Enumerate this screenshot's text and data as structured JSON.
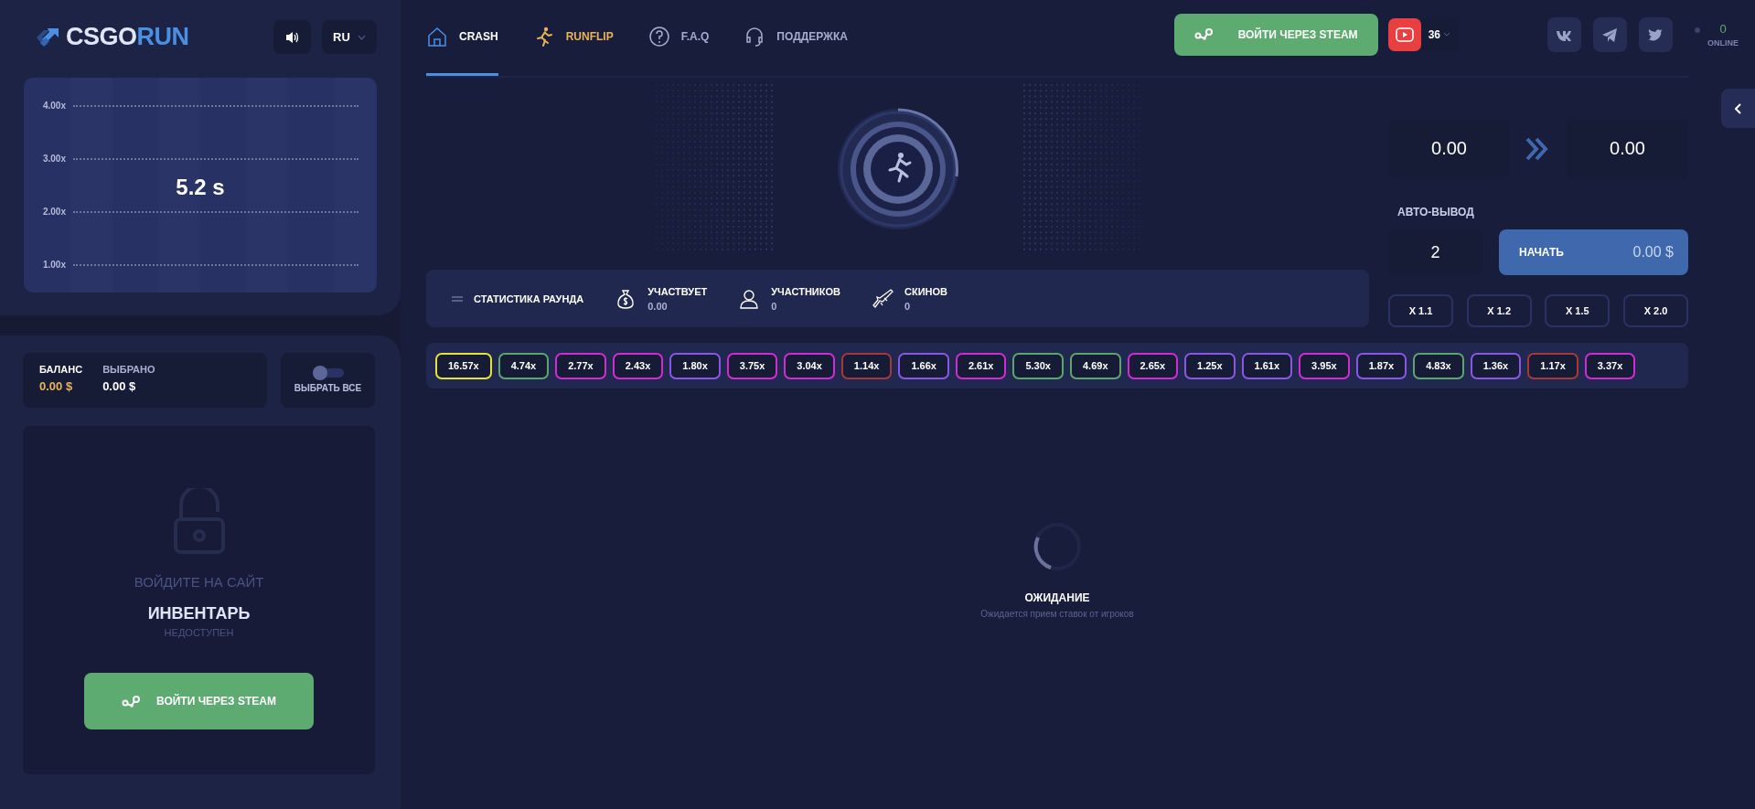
{
  "logo": {
    "text_main": "CSGO",
    "text_accent": "RUN"
  },
  "language": {
    "code": "RU"
  },
  "timer_chart": {
    "y_labels": [
      "4.00x",
      "3.00x",
      "2.00x",
      "1.00x"
    ],
    "countdown": "5.2 s"
  },
  "wallet": {
    "balance_label": "БАЛАНС",
    "balance_value": "0.00 $",
    "chosen_label": "ВЫБРАНО",
    "chosen_value": "0.00 $"
  },
  "select_all": {
    "label": "ВЫБРАТЬ ВСЕ",
    "on": false
  },
  "inventory": {
    "notice": "ВОЙДИТЕ НА САЙТ",
    "title": "ИНВЕНТАРЬ",
    "status": "НЕДОСТУПЕН",
    "login_button": "ВОЙТИ ЧЕРЕЗ STEAM"
  },
  "nav": [
    {
      "label": "CRASH",
      "kind": "home",
      "selected": true
    },
    {
      "label": "RUNFLIP",
      "kind": "runner",
      "selected": false
    },
    {
      "label": "F.A.Q",
      "kind": "faq",
      "selected": false
    },
    {
      "label": "ПОДДЕРЖКА",
      "kind": "support",
      "selected": false
    }
  ],
  "login_button": "ВОЙТИ ЧЕРЕЗ STEAM",
  "youtube": {
    "count": "36"
  },
  "socials": [
    {
      "kind": "vk"
    },
    {
      "kind": "telegram"
    },
    {
      "kind": "twitter"
    }
  ],
  "online": {
    "count": "0",
    "label": "ONLINE"
  },
  "bet": {
    "amount": "0.00",
    "payout": "0.00",
    "auto_label": "АВТО-ВЫВОД",
    "auto_value": "2",
    "start_label": "НАЧАТЬ",
    "start_amount": "0.00 $",
    "quick": [
      "X 1.1",
      "X 1.2",
      "X 1.5",
      "X 2.0"
    ]
  },
  "round_stats": {
    "title": "СТАТИСТИКА РАУНДА",
    "items": [
      {
        "kind": "money",
        "label": "УЧАСТВУЕТ",
        "value": "0.00"
      },
      {
        "kind": "players",
        "label": "УЧАСТНИКОВ",
        "value": "0"
      },
      {
        "kind": "skins",
        "label": "СКИНОВ",
        "value": "0"
      }
    ]
  },
  "history": [
    {
      "value": "16.57x",
      "color": "#e6e236"
    },
    {
      "value": "4.74x",
      "color": "#5aa66c"
    },
    {
      "value": "2.77x",
      "color": "#d22bd6"
    },
    {
      "value": "2.43x",
      "color": "#d22bd6"
    },
    {
      "value": "1.80x",
      "color": "#8b55e6"
    },
    {
      "value": "3.75x",
      "color": "#d22bd6"
    },
    {
      "value": "3.04x",
      "color": "#d22bd6"
    },
    {
      "value": "1.14x",
      "color": "#a83838"
    },
    {
      "value": "1.66x",
      "color": "#8b55e6"
    },
    {
      "value": "2.61x",
      "color": "#d22bd6"
    },
    {
      "value": "5.30x",
      "color": "#5aa66c"
    },
    {
      "value": "4.69x",
      "color": "#5aa66c"
    },
    {
      "value": "2.65x",
      "color": "#d22bd6"
    },
    {
      "value": "1.25x",
      "color": "#8b55e6"
    },
    {
      "value": "1.61x",
      "color": "#8b55e6"
    },
    {
      "value": "3.95x",
      "color": "#d22bd6"
    },
    {
      "value": "1.87x",
      "color": "#8b55e6"
    },
    {
      "value": "4.83x",
      "color": "#5aa66c"
    },
    {
      "value": "1.36x",
      "color": "#8b55e6"
    },
    {
      "value": "1.17x",
      "color": "#a83838"
    },
    {
      "value": "3.37x",
      "color": "#d22bd6"
    }
  ],
  "waiting": {
    "title": "ОЖИДАНИЕ",
    "subtitle": "Ожидается прием ставок от игроков"
  }
}
